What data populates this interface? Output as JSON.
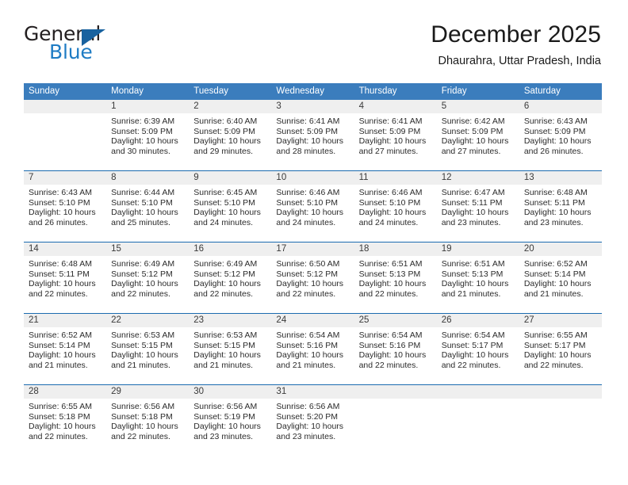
{
  "brand": {
    "name_part1": "General",
    "name_part2": "Blue",
    "triangle_color": "#18629f",
    "blue_color": "#1f7cc4"
  },
  "header": {
    "month_title": "December 2025",
    "location": "Dhaurahra, Uttar Pradesh, India"
  },
  "theme": {
    "header_bar": "#3b7dbd",
    "week_divider": "#1b6bb0",
    "daynum_band": "#efefef"
  },
  "weekdays": [
    "Sunday",
    "Monday",
    "Tuesday",
    "Wednesday",
    "Thursday",
    "Friday",
    "Saturday"
  ],
  "weeks": [
    [
      {
        "day": "",
        "sunrise": "",
        "sunset": "",
        "daylight": "",
        "empty": true
      },
      {
        "day": "1",
        "sunrise": "Sunrise: 6:39 AM",
        "sunset": "Sunset: 5:09 PM",
        "daylight": "Daylight: 10 hours and 30 minutes."
      },
      {
        "day": "2",
        "sunrise": "Sunrise: 6:40 AM",
        "sunset": "Sunset: 5:09 PM",
        "daylight": "Daylight: 10 hours and 29 minutes."
      },
      {
        "day": "3",
        "sunrise": "Sunrise: 6:41 AM",
        "sunset": "Sunset: 5:09 PM",
        "daylight": "Daylight: 10 hours and 28 minutes."
      },
      {
        "day": "4",
        "sunrise": "Sunrise: 6:41 AM",
        "sunset": "Sunset: 5:09 PM",
        "daylight": "Daylight: 10 hours and 27 minutes."
      },
      {
        "day": "5",
        "sunrise": "Sunrise: 6:42 AM",
        "sunset": "Sunset: 5:09 PM",
        "daylight": "Daylight: 10 hours and 27 minutes."
      },
      {
        "day": "6",
        "sunrise": "Sunrise: 6:43 AM",
        "sunset": "Sunset: 5:09 PM",
        "daylight": "Daylight: 10 hours and 26 minutes."
      }
    ],
    [
      {
        "day": "7",
        "sunrise": "Sunrise: 6:43 AM",
        "sunset": "Sunset: 5:10 PM",
        "daylight": "Daylight: 10 hours and 26 minutes."
      },
      {
        "day": "8",
        "sunrise": "Sunrise: 6:44 AM",
        "sunset": "Sunset: 5:10 PM",
        "daylight": "Daylight: 10 hours and 25 minutes."
      },
      {
        "day": "9",
        "sunrise": "Sunrise: 6:45 AM",
        "sunset": "Sunset: 5:10 PM",
        "daylight": "Daylight: 10 hours and 24 minutes."
      },
      {
        "day": "10",
        "sunrise": "Sunrise: 6:46 AM",
        "sunset": "Sunset: 5:10 PM",
        "daylight": "Daylight: 10 hours and 24 minutes."
      },
      {
        "day": "11",
        "sunrise": "Sunrise: 6:46 AM",
        "sunset": "Sunset: 5:10 PM",
        "daylight": "Daylight: 10 hours and 24 minutes."
      },
      {
        "day": "12",
        "sunrise": "Sunrise: 6:47 AM",
        "sunset": "Sunset: 5:11 PM",
        "daylight": "Daylight: 10 hours and 23 minutes."
      },
      {
        "day": "13",
        "sunrise": "Sunrise: 6:48 AM",
        "sunset": "Sunset: 5:11 PM",
        "daylight": "Daylight: 10 hours and 23 minutes."
      }
    ],
    [
      {
        "day": "14",
        "sunrise": "Sunrise: 6:48 AM",
        "sunset": "Sunset: 5:11 PM",
        "daylight": "Daylight: 10 hours and 22 minutes."
      },
      {
        "day": "15",
        "sunrise": "Sunrise: 6:49 AM",
        "sunset": "Sunset: 5:12 PM",
        "daylight": "Daylight: 10 hours and 22 minutes."
      },
      {
        "day": "16",
        "sunrise": "Sunrise: 6:49 AM",
        "sunset": "Sunset: 5:12 PM",
        "daylight": "Daylight: 10 hours and 22 minutes."
      },
      {
        "day": "17",
        "sunrise": "Sunrise: 6:50 AM",
        "sunset": "Sunset: 5:12 PM",
        "daylight": "Daylight: 10 hours and 22 minutes."
      },
      {
        "day": "18",
        "sunrise": "Sunrise: 6:51 AM",
        "sunset": "Sunset: 5:13 PM",
        "daylight": "Daylight: 10 hours and 22 minutes."
      },
      {
        "day": "19",
        "sunrise": "Sunrise: 6:51 AM",
        "sunset": "Sunset: 5:13 PM",
        "daylight": "Daylight: 10 hours and 21 minutes."
      },
      {
        "day": "20",
        "sunrise": "Sunrise: 6:52 AM",
        "sunset": "Sunset: 5:14 PM",
        "daylight": "Daylight: 10 hours and 21 minutes."
      }
    ],
    [
      {
        "day": "21",
        "sunrise": "Sunrise: 6:52 AM",
        "sunset": "Sunset: 5:14 PM",
        "daylight": "Daylight: 10 hours and 21 minutes."
      },
      {
        "day": "22",
        "sunrise": "Sunrise: 6:53 AM",
        "sunset": "Sunset: 5:15 PM",
        "daylight": "Daylight: 10 hours and 21 minutes."
      },
      {
        "day": "23",
        "sunrise": "Sunrise: 6:53 AM",
        "sunset": "Sunset: 5:15 PM",
        "daylight": "Daylight: 10 hours and 21 minutes."
      },
      {
        "day": "24",
        "sunrise": "Sunrise: 6:54 AM",
        "sunset": "Sunset: 5:16 PM",
        "daylight": "Daylight: 10 hours and 21 minutes."
      },
      {
        "day": "25",
        "sunrise": "Sunrise: 6:54 AM",
        "sunset": "Sunset: 5:16 PM",
        "daylight": "Daylight: 10 hours and 22 minutes."
      },
      {
        "day": "26",
        "sunrise": "Sunrise: 6:54 AM",
        "sunset": "Sunset: 5:17 PM",
        "daylight": "Daylight: 10 hours and 22 minutes."
      },
      {
        "day": "27",
        "sunrise": "Sunrise: 6:55 AM",
        "sunset": "Sunset: 5:17 PM",
        "daylight": "Daylight: 10 hours and 22 minutes."
      }
    ],
    [
      {
        "day": "28",
        "sunrise": "Sunrise: 6:55 AM",
        "sunset": "Sunset: 5:18 PM",
        "daylight": "Daylight: 10 hours and 22 minutes."
      },
      {
        "day": "29",
        "sunrise": "Sunrise: 6:56 AM",
        "sunset": "Sunset: 5:18 PM",
        "daylight": "Daylight: 10 hours and 22 minutes."
      },
      {
        "day": "30",
        "sunrise": "Sunrise: 6:56 AM",
        "sunset": "Sunset: 5:19 PM",
        "daylight": "Daylight: 10 hours and 23 minutes."
      },
      {
        "day": "31",
        "sunrise": "Sunrise: 6:56 AM",
        "sunset": "Sunset: 5:20 PM",
        "daylight": "Daylight: 10 hours and 23 minutes."
      },
      {
        "day": "",
        "sunrise": "",
        "sunset": "",
        "daylight": "",
        "empty": true
      },
      {
        "day": "",
        "sunrise": "",
        "sunset": "",
        "daylight": "",
        "empty": true
      },
      {
        "day": "",
        "sunrise": "",
        "sunset": "",
        "daylight": "",
        "empty": true
      }
    ]
  ]
}
